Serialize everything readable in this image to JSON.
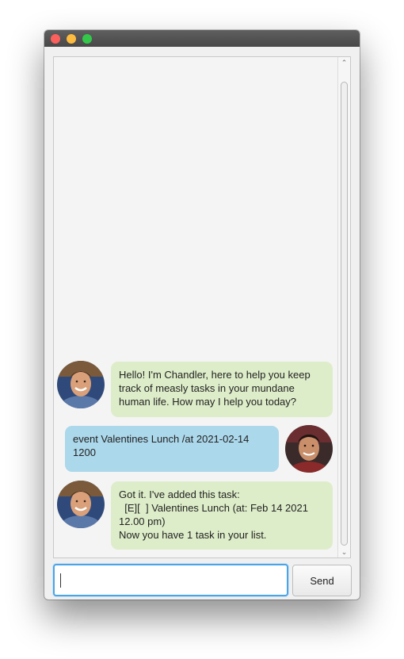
{
  "window": {
    "controls": [
      "close",
      "minimize",
      "maximize"
    ]
  },
  "dialog": {
    "messages": [
      {
        "sender": "bot",
        "avatar": "chandler-avatar",
        "text": "Hello! I'm Chandler, here to help you keep\ntrack of measly tasks in your mundane\nhuman life. How may I help you today?"
      },
      {
        "sender": "user",
        "avatar": "joey-avatar",
        "text": "event Valentines Lunch /at 2021-02-14\n1200"
      },
      {
        "sender": "bot",
        "avatar": "chandler-avatar",
        "text": "Got it. I've added this task:\n  [E][  ] Valentines Lunch (at: Feb 14 2021\n12.00 pm)\nNow you have 1 task in your list."
      }
    ]
  },
  "input": {
    "value": "",
    "send_label": "Send"
  },
  "colors": {
    "bot_bubble": "#deedc9",
    "user_bubble": "#acd8eb",
    "focus_border": "#4ca3e6"
  }
}
